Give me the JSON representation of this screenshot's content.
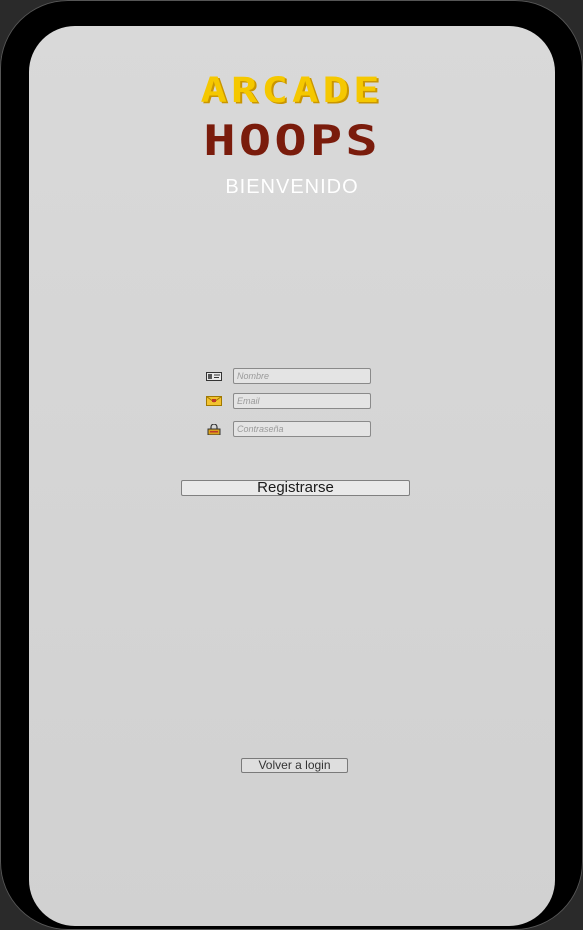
{
  "logo": {
    "line1": "ARCADE",
    "line2": "HOOPS"
  },
  "welcome": "BIENVENIDO",
  "form": {
    "name_placeholder": "Nombre",
    "email_placeholder": "Email",
    "password_placeholder": "Contraseña",
    "register_label": "Registrarse"
  },
  "back_label": "Volver a login",
  "colors": {
    "accent_yellow": "#f5c800",
    "accent_red": "#7a1c0c",
    "screen_bg": "#d6d6d6"
  },
  "icons": [
    "id-card-icon",
    "email-icon",
    "lock-icon"
  ]
}
